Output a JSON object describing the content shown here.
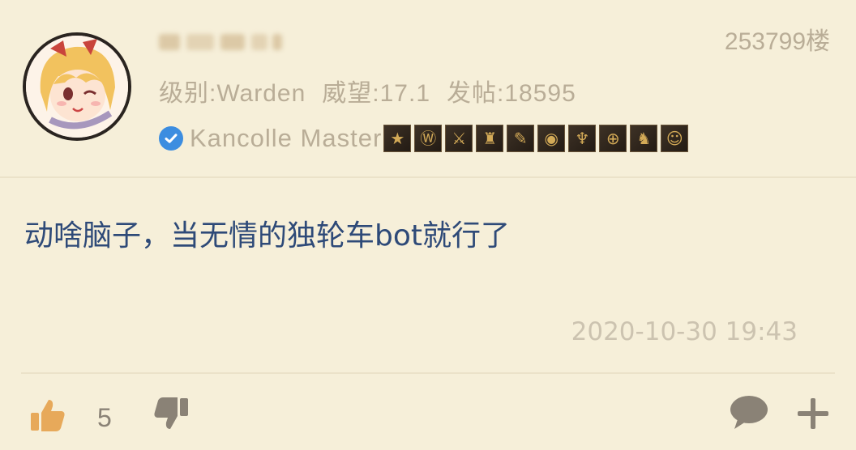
{
  "post": {
    "floor_label": "253799楼",
    "stats": {
      "level_label": "级别:",
      "level_value": "Warden",
      "prestige_label": "威望:",
      "prestige_value": "17.1",
      "posts_label": "发帖:",
      "posts_value": "18595"
    },
    "user_title": "Kancolle Master",
    "badge_icons": [
      "star-badge-icon",
      "w-badge-icon",
      "sword-badge-icon",
      "figure-badge-icon",
      "quill-badge-icon",
      "ring-badge-icon",
      "hand-badge-icon",
      "gear-badge-icon",
      "beast-badge-icon",
      "face-badge-icon"
    ],
    "content": "动啥脑子，当无情的独轮车bot就行了",
    "timestamp": "2020-10-30 19:43",
    "like_count": "5"
  },
  "colors": {
    "background": "#f6efd9",
    "meta_text": "#b9ad97",
    "content_text": "#2e4a78",
    "verified_badge": "#3c8de0",
    "like_icon": "#e7a95a",
    "action_icon": "#8a8276"
  }
}
